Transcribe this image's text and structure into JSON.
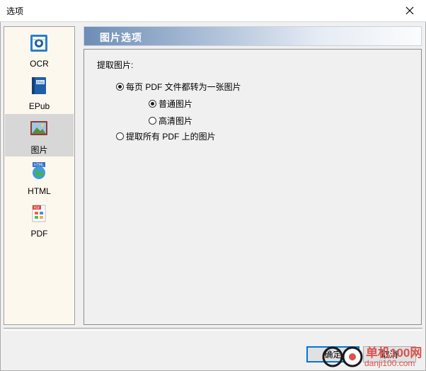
{
  "window": {
    "title": "选项"
  },
  "sidebar": {
    "items": [
      {
        "label": "OCR",
        "icon": "ocr-icon",
        "selected": false
      },
      {
        "label": "EPub",
        "icon": "epub-book-icon",
        "selected": false
      },
      {
        "label": "图片",
        "icon": "image-icon",
        "selected": true
      },
      {
        "label": "HTML",
        "icon": "html-globe-icon",
        "selected": false
      },
      {
        "label": "PDF",
        "icon": "pdf-document-icon",
        "selected": false
      }
    ]
  },
  "content": {
    "header": "图片选项",
    "group_label": "提取图片:",
    "options": {
      "convert_each_page": "每页 PDF 文件都转为一张图片",
      "normal_image": "普通图片",
      "hd_image": "高清图片",
      "extract_all": "提取所有 PDF 上的图片"
    },
    "selected": {
      "mode": "convert_each_page",
      "quality": "normal_image"
    }
  },
  "buttons": {
    "ok": "确定",
    "cancel": "取消"
  },
  "watermark": {
    "line1": "单机100网",
    "line2": "danji100.com"
  },
  "colors": {
    "selected_item_bg": "#d7d7d7",
    "sidebar_bg": "#fdf8ee",
    "default_button_border": "#0078d7",
    "watermark": "#d9534f"
  }
}
